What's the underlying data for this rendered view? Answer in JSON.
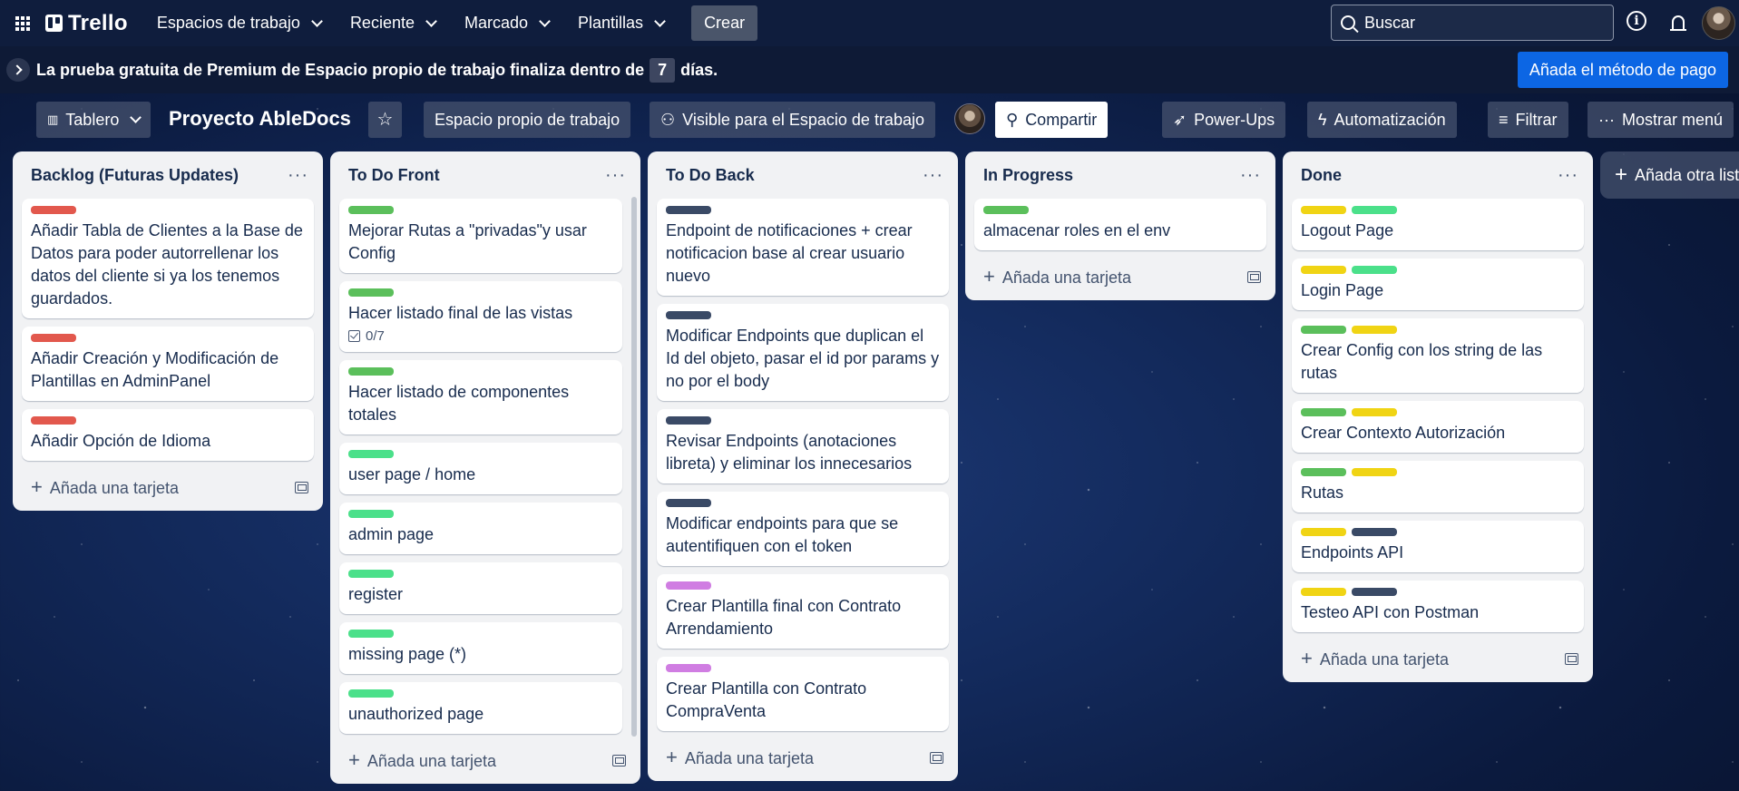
{
  "topbar": {
    "logo": "Trello",
    "nav": [
      {
        "label": "Espacios de trabajo"
      },
      {
        "label": "Reciente"
      },
      {
        "label": "Marcado"
      },
      {
        "label": "Plantillas"
      }
    ],
    "create_label": "Crear",
    "search_placeholder": "Buscar"
  },
  "banner": {
    "text_before": "La prueba gratuita de Premium de Espacio propio de trabajo finaliza dentro de",
    "days": "7",
    "text_after": "días.",
    "pay_button": "Añada el método de pago"
  },
  "board": {
    "view_label": "Tablero",
    "title": "Proyecto AbleDocs",
    "workspace_label": "Espacio propio de trabajo",
    "visibility_label": "Visible para el Espacio de trabajo",
    "share_label": "Compartir",
    "powerups_label": "Power-Ups",
    "automation_label": "Automatización",
    "filter_label": "Filtrar",
    "menu_label": "Mostrar menú",
    "add_list_label": "Añada otra lista",
    "add_card_label": "Añada una tarjeta"
  },
  "colors": {
    "red": "#e2584d",
    "green": "#5bbf5b",
    "mint": "#4be08a",
    "dark": "#3a4a66",
    "purple": "#d07de2",
    "yellow": "#f0d414"
  },
  "lists": [
    {
      "title": "Backlog (Futuras Updates)",
      "cards": [
        {
          "labels": [
            "red"
          ],
          "title": "Añadir Tabla de Clientes a la Base de Datos para poder autorrellenar los datos del cliente si ya los tenemos guardados."
        },
        {
          "labels": [
            "red"
          ],
          "title": "Añadir Creación y Modificación de Plantillas en AdminPanel"
        },
        {
          "labels": [
            "red"
          ],
          "title": "Añadir Opción de Idioma"
        }
      ]
    },
    {
      "title": "To Do Front",
      "cards": [
        {
          "labels": [
            "green"
          ],
          "title": "Mejorar Rutas a \"privadas\"y usar Config"
        },
        {
          "labels": [
            "green"
          ],
          "title": "Hacer listado final de las vistas",
          "checklist": "0/7"
        },
        {
          "labels": [
            "green"
          ],
          "title": "Hacer listado de componentes totales"
        },
        {
          "labels": [
            "mint"
          ],
          "title": "user page / home"
        },
        {
          "labels": [
            "mint"
          ],
          "title": "admin page"
        },
        {
          "labels": [
            "mint"
          ],
          "title": "register"
        },
        {
          "labels": [
            "mint"
          ],
          "title": "missing page (*)"
        },
        {
          "labels": [
            "mint"
          ],
          "title": "unauthorized page"
        }
      ]
    },
    {
      "title": "To Do Back",
      "cards": [
        {
          "labels": [
            "dark"
          ],
          "title": "Endpoint de notificaciones + crear notificacion base al crear usuario nuevo"
        },
        {
          "labels": [
            "dark"
          ],
          "title": "Modificar Endpoints que duplican el Id del objeto, pasar el id por params y no por el body"
        },
        {
          "labels": [
            "dark"
          ],
          "title": "Revisar Endpoints (anotaciones libreta) y eliminar los innecesarios"
        },
        {
          "labels": [
            "dark"
          ],
          "title": "Modificar endpoints para que se autentifiquen con el token"
        },
        {
          "labels": [
            "purple"
          ],
          "title": "Crear Plantilla final con Contrato Arrendamiento"
        },
        {
          "labels": [
            "purple"
          ],
          "title": "Crear Plantilla con Contrato CompraVenta"
        }
      ]
    },
    {
      "title": "In Progress",
      "cards": [
        {
          "labels": [
            "green"
          ],
          "title": "almacenar roles en el env"
        }
      ]
    },
    {
      "title": "Done",
      "cards": [
        {
          "labels": [
            "yellow",
            "mint"
          ],
          "title": "Logout Page"
        },
        {
          "labels": [
            "yellow",
            "mint"
          ],
          "title": "Login Page"
        },
        {
          "labels": [
            "green",
            "yellow"
          ],
          "title": "Crear Config con los string de las rutas"
        },
        {
          "labels": [
            "green",
            "yellow"
          ],
          "title": "Crear Contexto Autorización"
        },
        {
          "labels": [
            "green",
            "yellow"
          ],
          "title": "Rutas"
        },
        {
          "labels": [
            "yellow",
            "dark"
          ],
          "title": "Endpoints API"
        },
        {
          "labels": [
            "yellow",
            "dark"
          ],
          "title": "Testeo API con Postman"
        }
      ]
    }
  ]
}
